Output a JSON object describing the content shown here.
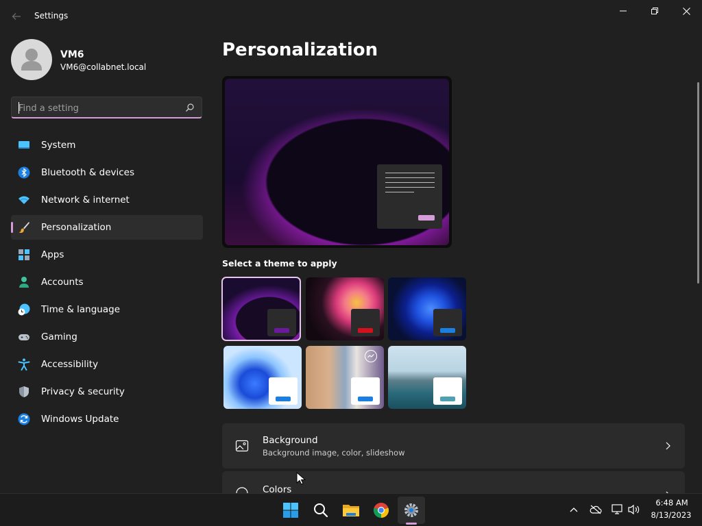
{
  "window": {
    "title": "Settings",
    "controls": [
      "minimize",
      "restore",
      "close"
    ]
  },
  "user": {
    "name": "VM6",
    "email": "VM6@collabnet.local"
  },
  "search": {
    "placeholder": "Find a setting",
    "value": ""
  },
  "sidebar": {
    "items": [
      {
        "label": "System",
        "icon": "monitor-icon"
      },
      {
        "label": "Bluetooth & devices",
        "icon": "bluetooth-icon"
      },
      {
        "label": "Network & internet",
        "icon": "wifi-icon"
      },
      {
        "label": "Personalization",
        "icon": "brush-icon",
        "selected": true
      },
      {
        "label": "Apps",
        "icon": "apps-icon"
      },
      {
        "label": "Accounts",
        "icon": "person-icon"
      },
      {
        "label": "Time & language",
        "icon": "clock-globe-icon"
      },
      {
        "label": "Gaming",
        "icon": "gamepad-icon"
      },
      {
        "label": "Accessibility",
        "icon": "accessibility-icon"
      },
      {
        "label": "Privacy & security",
        "icon": "shield-icon"
      },
      {
        "label": "Windows Update",
        "icon": "update-icon"
      }
    ]
  },
  "main": {
    "title": "Personalization",
    "theme_heading": "Select a theme to apply",
    "cards": [
      {
        "title": "Background",
        "subtitle": "Background image, color, slideshow",
        "icon": "image-icon"
      },
      {
        "title": "Colors",
        "subtitle": "",
        "icon": "palette-icon"
      }
    ]
  },
  "colors": {
    "accent": "#d69bd9",
    "background": "#202020",
    "card": "#2b2b2b"
  },
  "taskbar": {
    "apps": [
      "start-icon",
      "search-icon",
      "file-explorer-icon",
      "chrome-icon",
      "settings-icon"
    ],
    "clock": {
      "time": "6:48 AM",
      "date": "8/13/2023"
    }
  }
}
